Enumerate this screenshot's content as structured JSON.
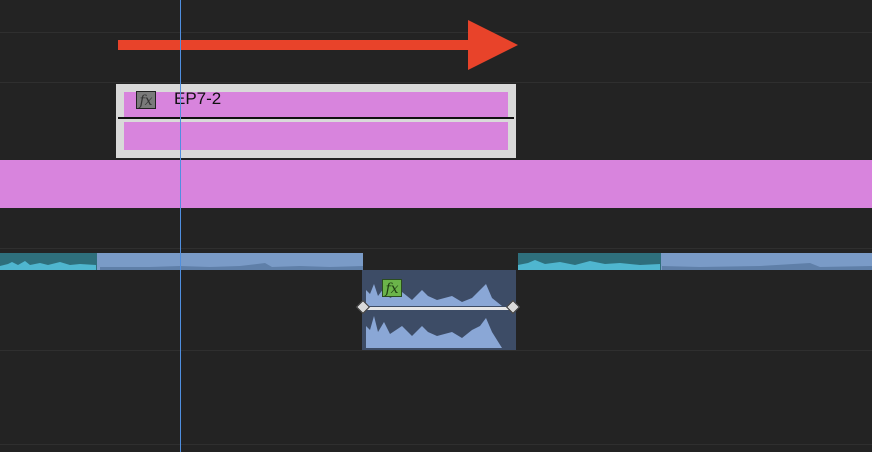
{
  "timeline": {
    "video_clip": {
      "name": "EP7-2",
      "fx_label": "fx",
      "color": "#d884dd",
      "selected": true
    },
    "audio_clip": {
      "fx_label": "fx",
      "fx_color": "#6bb44a",
      "selected": true
    },
    "arrow": {
      "color": "#e8432a",
      "direction": "right"
    },
    "playhead_color": "#4f8fe0"
  }
}
